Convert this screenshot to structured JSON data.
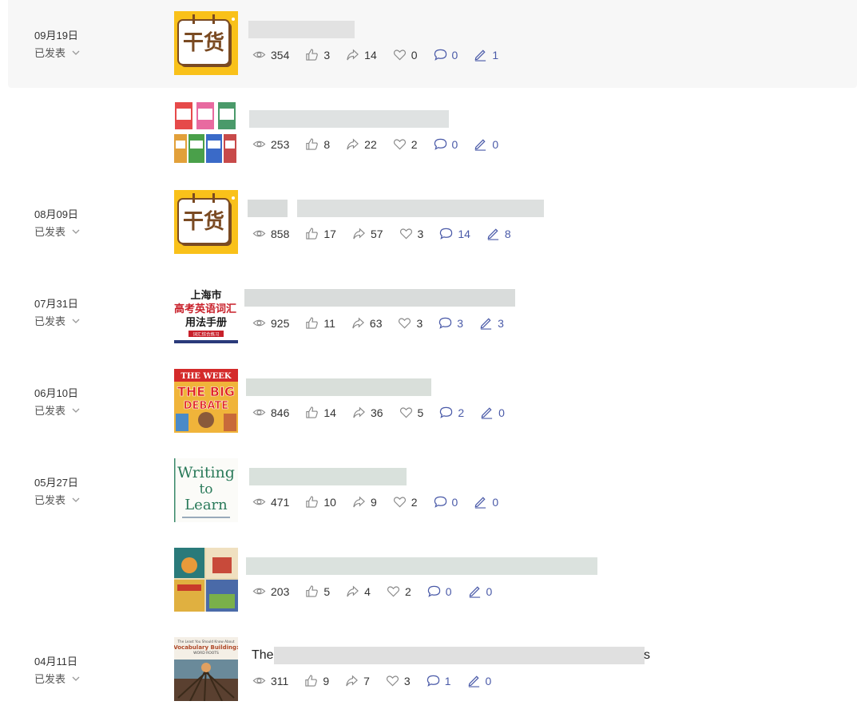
{
  "status_label": "已发表",
  "colors": {
    "stat_dark": "#333333",
    "stat_blue": "#4a5aa8",
    "highlight_row": "#f7f7f7"
  },
  "rows": [
    {
      "date": "09月19日",
      "status": "已发表",
      "thumb": "ganhuo",
      "thumb_text": "干货",
      "title_visible": "",
      "views": "354",
      "likes": "3",
      "shares": "14",
      "favorites": "0",
      "comments": "0",
      "edits": "1"
    },
    {
      "date": "",
      "status": "",
      "thumb": "grid-covers",
      "title_visible": "",
      "views": "253",
      "likes": "8",
      "shares": "22",
      "favorites": "2",
      "comments": "0",
      "edits": "0"
    },
    {
      "date": "08月09日",
      "status": "已发表",
      "thumb": "ganhuo",
      "thumb_text": "干货",
      "title_visible": "",
      "views": "858",
      "likes": "17",
      "shares": "57",
      "favorites": "3",
      "comments": "14",
      "edits": "8"
    },
    {
      "date": "07月31日",
      "status": "已发表",
      "thumb": "shanghai-book",
      "thumb_lines": [
        "上海市",
        "高考英语词汇",
        "用法手册",
        "词汇综合练习"
      ],
      "title_visible": "",
      "views": "925",
      "likes": "11",
      "shares": "63",
      "favorites": "3",
      "comments": "3",
      "edits": "3"
    },
    {
      "date": "06月10日",
      "status": "已发表",
      "thumb": "big-debate",
      "thumb_lines": [
        "THE WEEK",
        "THE BIG",
        "DEBATE"
      ],
      "title_visible": "",
      "views": "846",
      "likes": "14",
      "shares": "36",
      "favorites": "5",
      "comments": "2",
      "edits": "0"
    },
    {
      "date": "05月27日",
      "status": "已发表",
      "thumb": "writing-to-learn",
      "thumb_lines": [
        "Writing",
        "to",
        "Learn"
      ],
      "title_visible": "",
      "views": "471",
      "likes": "10",
      "shares": "9",
      "favorites": "2",
      "comments": "0",
      "edits": "0"
    },
    {
      "date": "",
      "status": "",
      "thumb": "collage",
      "title_visible": "",
      "views": "203",
      "likes": "5",
      "shares": "4",
      "favorites": "2",
      "comments": "0",
      "edits": "0"
    },
    {
      "date": "04月11日",
      "status": "已发表",
      "thumb": "vocabulary-book",
      "thumb_lines": [
        "The Least You Should Know About",
        "Vocabulary Building:",
        "WORD ROOTS"
      ],
      "title_visible": "The",
      "title_tail": "s",
      "views": "311",
      "likes": "9",
      "shares": "7",
      "favorites": "3",
      "comments": "1",
      "edits": "0"
    }
  ]
}
